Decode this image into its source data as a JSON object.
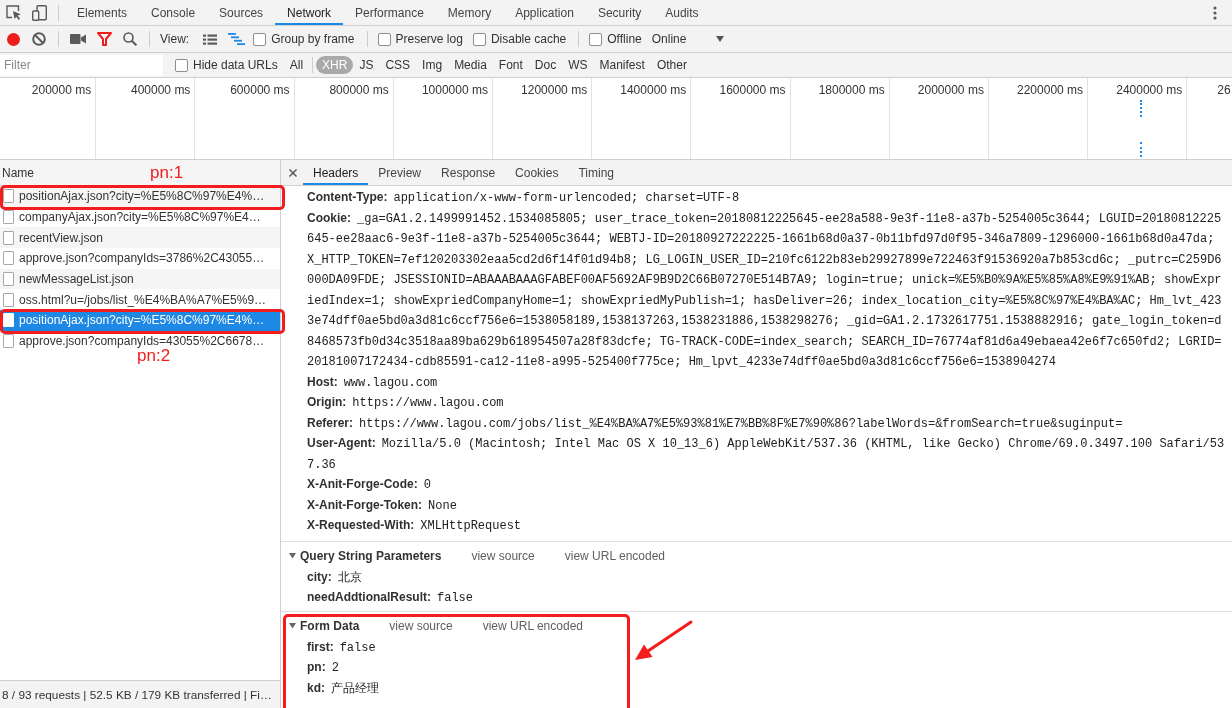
{
  "main_tabs": [
    {
      "label": "Elements",
      "selected": false
    },
    {
      "label": "Console",
      "selected": false
    },
    {
      "label": "Sources",
      "selected": false
    },
    {
      "label": "Network",
      "selected": true
    },
    {
      "label": "Performance",
      "selected": false
    },
    {
      "label": "Memory",
      "selected": false
    },
    {
      "label": "Application",
      "selected": false
    },
    {
      "label": "Security",
      "selected": false
    },
    {
      "label": "Audits",
      "selected": false
    }
  ],
  "toolbar": {
    "recording": true,
    "filter_shown": true,
    "view_label": "View:",
    "view_modes": [
      {
        "kind": "list",
        "selected": false
      },
      {
        "kind": "waterfall",
        "selected": true
      }
    ],
    "option_groups": [
      {
        "options": [
          {
            "label": "Group by frame",
            "checked": false
          }
        ]
      },
      {
        "options": [
          {
            "label": "Preserve log",
            "checked": false
          },
          {
            "label": "Disable cache",
            "checked": false
          }
        ]
      },
      {
        "options": [
          {
            "label": "Offline",
            "checked": false
          }
        ]
      }
    ],
    "throttling": "Online"
  },
  "filter_bar": {
    "placeholder": "Filter",
    "hide_data_urls": {
      "label": "Hide data URLs",
      "checked": false
    },
    "types": [
      {
        "label": "All",
        "selected": false
      },
      {
        "label": "XHR",
        "selected": true
      },
      {
        "label": "JS",
        "selected": false
      },
      {
        "label": "CSS",
        "selected": false
      },
      {
        "label": "Img",
        "selected": false
      },
      {
        "label": "Media",
        "selected": false
      },
      {
        "label": "Font",
        "selected": false
      },
      {
        "label": "Doc",
        "selected": false
      },
      {
        "label": "WS",
        "selected": false
      },
      {
        "label": "Manifest",
        "selected": false
      },
      {
        "label": "Other",
        "selected": false
      }
    ]
  },
  "overview": {
    "ticks": [
      "200000 ms",
      "400000 ms",
      "600000 ms",
      "800000 ms",
      "1000000 ms",
      "1200000 ms",
      "1400000 ms",
      "1600000 ms",
      "1800000 ms",
      "2000000 ms",
      "2200000 ms",
      "2400000 ms",
      "26"
    ]
  },
  "requests_header": "Name",
  "requests": [
    {
      "name": "positionAjax.json?city=%E5%8C%97%E4%…",
      "selected": false,
      "highlighted": true,
      "note_above": "pn:1"
    },
    {
      "name": "companyAjax.json?city=%E5%8C%97%E4…",
      "selected": false,
      "highlighted": false
    },
    {
      "name": "recentView.json",
      "selected": false,
      "highlighted": false
    },
    {
      "name": "approve.json?companyIds=3786%2C43055…",
      "selected": false,
      "highlighted": false
    },
    {
      "name": "newMessageList.json",
      "selected": false,
      "highlighted": false
    },
    {
      "name": "oss.html?u=/jobs/list_%E4%BA%A7%E5%9…",
      "selected": false,
      "highlighted": false
    },
    {
      "name": "positionAjax.json?city=%E5%8C%97%E4%…",
      "selected": true,
      "highlighted": true,
      "note_below": "pn:2"
    },
    {
      "name": "approve.json?companyIds=43055%2C6678…",
      "selected": false,
      "highlighted": false
    }
  ],
  "summary": "8 / 93 requests | 52.5 KB / 179 KB transferred | Fi…",
  "detail_tabs": [
    {
      "label": "Headers",
      "selected": true
    },
    {
      "label": "Preview",
      "selected": false
    },
    {
      "label": "Response",
      "selected": false
    },
    {
      "label": "Cookies",
      "selected": false
    },
    {
      "label": "Timing",
      "selected": false
    }
  ],
  "request_headers": [
    {
      "name": "Content-Type:",
      "value": "application/x-www-form-urlencoded; charset=UTF-8"
    },
    {
      "name": "Cookie:",
      "value": "_ga=GA1.2.1499991452.1534085805; user_trace_token=20180812225645-ee28a588-9e3f-11e8-a37b-5254005c3644; LGUID=20180812225645-ee28aac6-9e3f-11e8-a37b-5254005c3644; WEBTJ-ID=20180927222225-1661b68d0a37-0b11bfd97d0f95-346a7809-1296000-1661b68d0a47da; X_HTTP_TOKEN=7ef120203302eaa5cd2d6f14f01d94b8; LG_LOGIN_USER_ID=210fc6122b83eb29927899e722463f91536920a7b853cd6c; _putrc=C259D6000DA09FDE; JSESSIONID=ABAAABAAAGFABEF00AF5692AF9B9D2C66B07270E514B7A9; login=true; unick=%E5%B0%9A%E5%85%A8%E9%91%AB; showExpriedIndex=1; showExpriedCompanyHome=1; showExpriedMyPublish=1; hasDeliver=26; index_location_city=%E5%8C%97%E4%BA%AC; Hm_lvt_4233e74dff0ae5bd0a3d81c6ccf756e6=1538058189,1538137263,1538231886,1538298276; _gid=GA1.2.1732617751.1538882916; gate_login_token=d8468573fb0d34c3518aa89ba629b618954507a28f83dcfe; TG-TRACK-CODE=index_search; SEARCH_ID=76774af81d6a49ebaea42e6f7c650fd2; LGRID=20181007172434-cdb85591-ca12-11e8-a995-525400f775ce; Hm_lpvt_4233e74dff0ae5bd0a3d81c6ccf756e6=1538904274"
    },
    {
      "name": "Host:",
      "value": "www.lagou.com"
    },
    {
      "name": "Origin:",
      "value": "https://www.lagou.com"
    },
    {
      "name": "Referer:",
      "value": "https://www.lagou.com/jobs/list_%E4%BA%A7%E5%93%81%E7%BB%8F%E7%90%86?labelWords=&fromSearch=true&suginput="
    },
    {
      "name": "User-Agent:",
      "value": "Mozilla/5.0 (Macintosh; Intel Mac OS X 10_13_6) AppleWebKit/537.36 (KHTML, like Gecko) Chrome/69.0.3497.100 Safari/537.36"
    },
    {
      "name": "X-Anit-Forge-Code:",
      "value": "0"
    },
    {
      "name": "X-Anit-Forge-Token:",
      "value": "None"
    },
    {
      "name": "X-Requested-With:",
      "value": "XMLHttpRequest"
    }
  ],
  "query_string_parameters": {
    "title": "Query String Parameters",
    "expanded": true,
    "links": [
      "view source",
      "view URL encoded"
    ],
    "params": [
      {
        "name": "city:",
        "value": "北京"
      },
      {
        "name": "needAddtionalResult:",
        "value": "false"
      }
    ]
  },
  "form_data": {
    "title": "Form Data",
    "expanded": true,
    "highlighted": true,
    "links": [
      "view source",
      "view URL encoded"
    ],
    "params": [
      {
        "name": "first:",
        "value": "false"
      },
      {
        "name": "pn:",
        "value": "2"
      },
      {
        "name": "kd:",
        "value": "产品经理"
      }
    ]
  }
}
